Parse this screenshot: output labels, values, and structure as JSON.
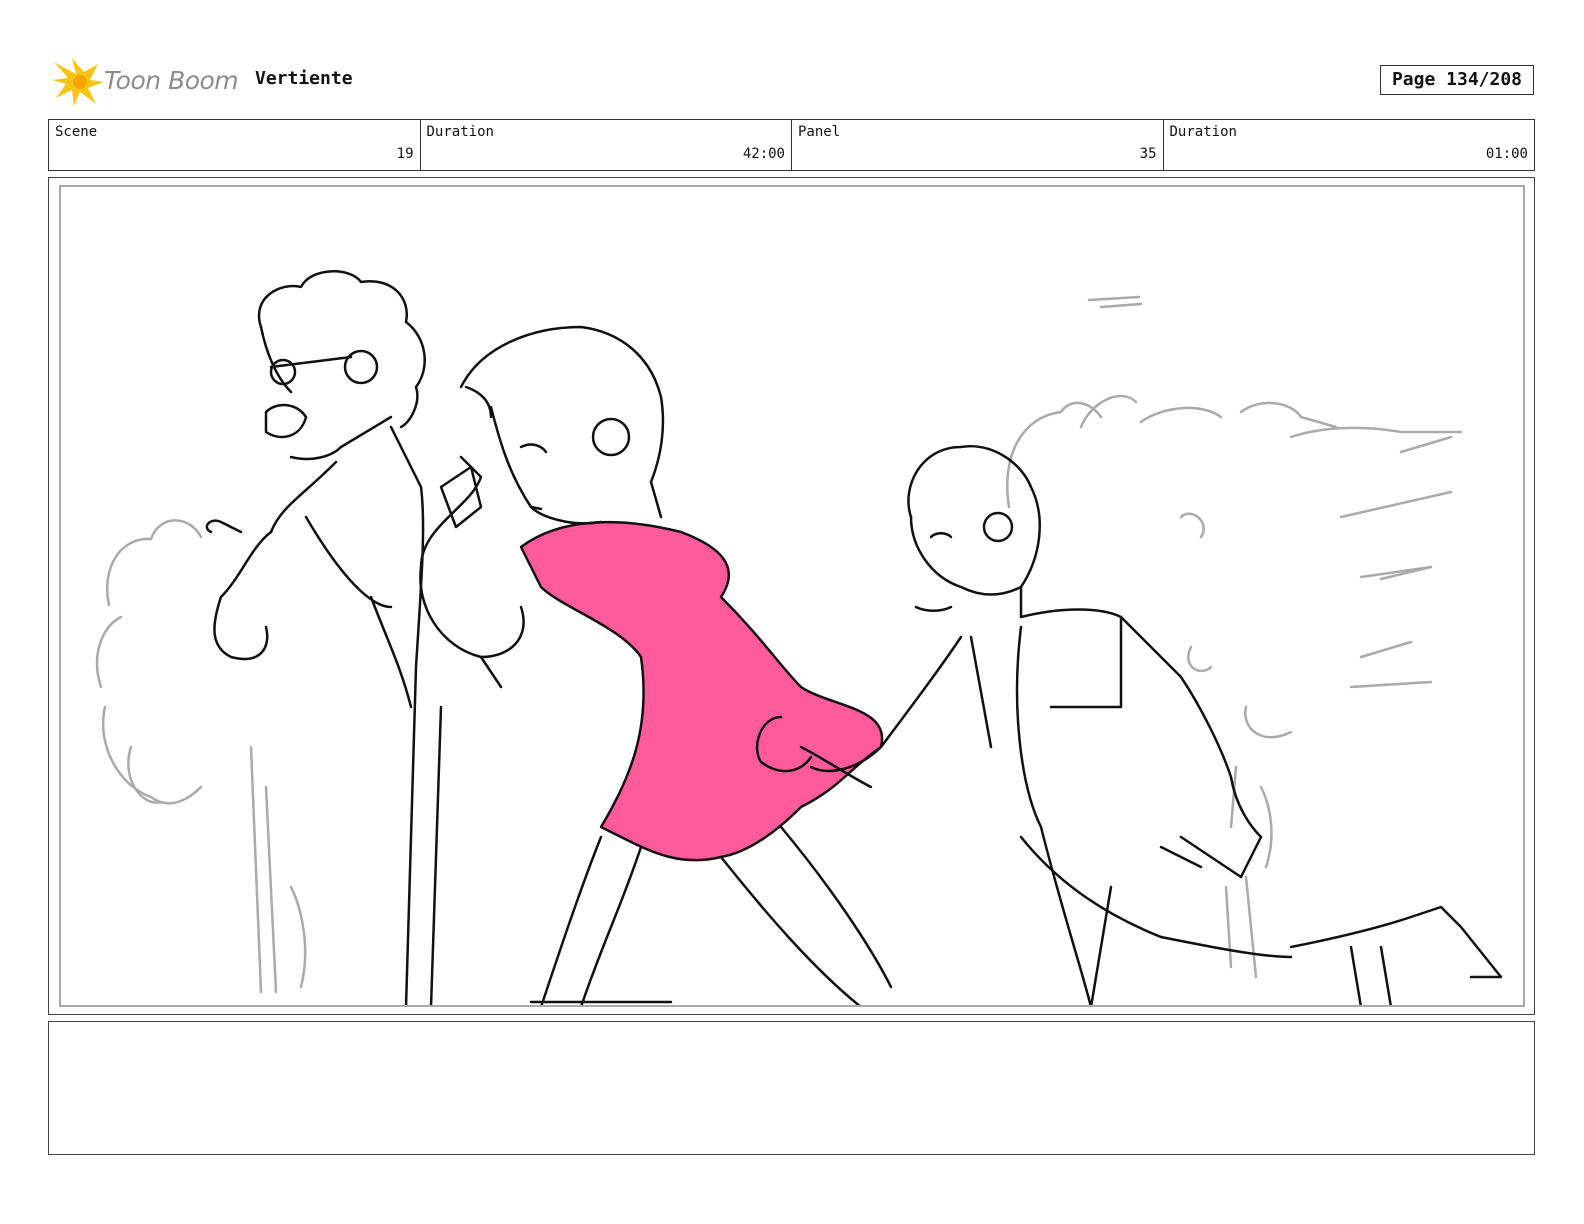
{
  "header": {
    "logo_text": "Toon Boom",
    "project_title": "Vertiente",
    "page_label": "Page 134/208"
  },
  "info": {
    "scene_label": "Scene",
    "scene_value": "19",
    "scene_duration_label": "Duration",
    "scene_duration_value": "42:00",
    "panel_label": "Panel",
    "panel_value": "35",
    "panel_duration_label": "Duration",
    "panel_duration_value": "01:00"
  },
  "colors": {
    "accent_pink": "#ff5b9b",
    "logo_yellow": "#f5c518"
  },
  "notes": {
    "text": ""
  }
}
